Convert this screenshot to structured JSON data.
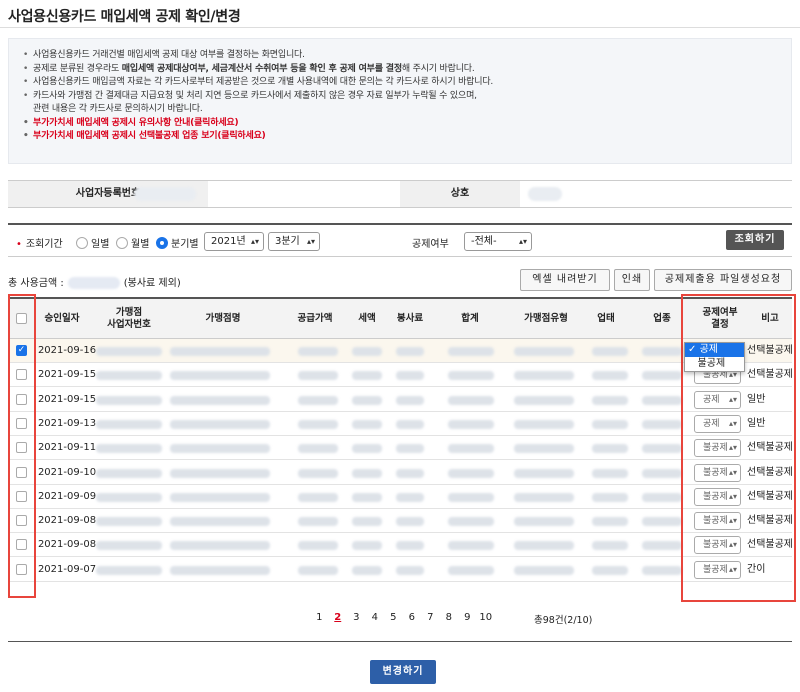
{
  "page_title": "사업용신용카드 매입세액 공제 확인/변경",
  "notice": {
    "lines": [
      {
        "pre": "사업용신용카드 거래건별 매입세액 공제 대상 여부를 결정하는 화면입니다.",
        "bold": "",
        "post": ""
      },
      {
        "pre": "공제로 분류된 경우라도 ",
        "bold": "매입세액 공제대상여부, 세금계산서 수취여부 등을 확인 후 공제 여부를 결정",
        "post": "해 주시기 바랍니다."
      },
      {
        "pre": "사업용신용카드 매입금액 자료는 각 카드사로부터 제공받은 것으로 개별 사용내역에 대한 문의는 각 카드사로 하시기 바랍니다.",
        "bold": "",
        "post": ""
      },
      {
        "pre": "카드사와 가맹점 간 결제대금 지급요청 및 처리 지연 등으로 카드사에서 제출하지 않은 경우 자료 일부가 누락될 수 있으며,",
        "bold": "",
        "post": ""
      }
    ],
    "continuation": "관련 내용은 각 카드사로 문의하시기 바랍니다.",
    "link1": "부가가치세 매입세액 공제시 유의사항 안내(클릭하세요)",
    "link2": "부가가치세 매입세액 공제시 선택불공제 업종 보기(클릭하세요)"
  },
  "bizinfo": {
    "reg_no_label": "사업자등록번호",
    "name_label": "상호"
  },
  "search": {
    "period_label": "조회기간",
    "radio_daily": "일별",
    "radio_monthly": "월별",
    "radio_quarterly": "분기별",
    "year_value": "2021년",
    "quarter_value": "3분기",
    "deduction_label": "공제여부",
    "deduction_value": "-전체-",
    "search_button": "조회하기"
  },
  "summary": {
    "total_label": "총 사용금액 :",
    "excluded_note": "(봉사료 제외)"
  },
  "toolbar": {
    "excel": "엑셀 내려받기",
    "print": "인쇄",
    "file": "공제제출용 파일생성요청"
  },
  "table": {
    "headers": {
      "approval_date": "승인일자",
      "merchant_bizno": "가맹점\n사업자번호",
      "merchant_name": "가맹점명",
      "supply_amount": "공급가액",
      "tax": "세액",
      "service_fee": "봉사료",
      "total": "합계",
      "merchant_type": "가맹점유형",
      "business_type": "업태",
      "business_item": "업종",
      "deduction_decision": "공제여부\n결정",
      "remarks": "비고"
    },
    "rows": [
      {
        "date": "2021-09-16",
        "checked": true,
        "deduction": "공제",
        "note": "선택불공제"
      },
      {
        "date": "2021-09-15",
        "checked": false,
        "deduction": "불공제",
        "note": "선택불공제"
      },
      {
        "date": "2021-09-15",
        "checked": false,
        "deduction": "공제",
        "note": "일반"
      },
      {
        "date": "2021-09-13",
        "checked": false,
        "deduction": "공제",
        "note": "일반"
      },
      {
        "date": "2021-09-11",
        "checked": false,
        "deduction": "불공제",
        "note": "선택불공제"
      },
      {
        "date": "2021-09-10",
        "checked": false,
        "deduction": "불공제",
        "note": "선택불공제"
      },
      {
        "date": "2021-09-09",
        "checked": false,
        "deduction": "불공제",
        "note": "선택불공제"
      },
      {
        "date": "2021-09-08",
        "checked": false,
        "deduction": "불공제",
        "note": "선택불공제"
      },
      {
        "date": "2021-09-08",
        "checked": false,
        "deduction": "불공제",
        "note": "선택불공제"
      },
      {
        "date": "2021-09-07",
        "checked": false,
        "deduction": "불공제",
        "note": "간이"
      }
    ],
    "dropdown_options": [
      "공제",
      "불공제"
    ],
    "dropdown_selected": "공제"
  },
  "pagination": {
    "pages": [
      "1",
      "2",
      "3",
      "4",
      "5",
      "6",
      "7",
      "8",
      "9",
      "10"
    ],
    "current": "2",
    "total_text": "총98건(2/10)"
  },
  "submit_button": "변경하기",
  "colors": {
    "accent_blue": "#1a73e8",
    "alert_red": "#d9001b",
    "highlight_red": "#e8453c",
    "submit_blue": "#2d5fa8"
  }
}
